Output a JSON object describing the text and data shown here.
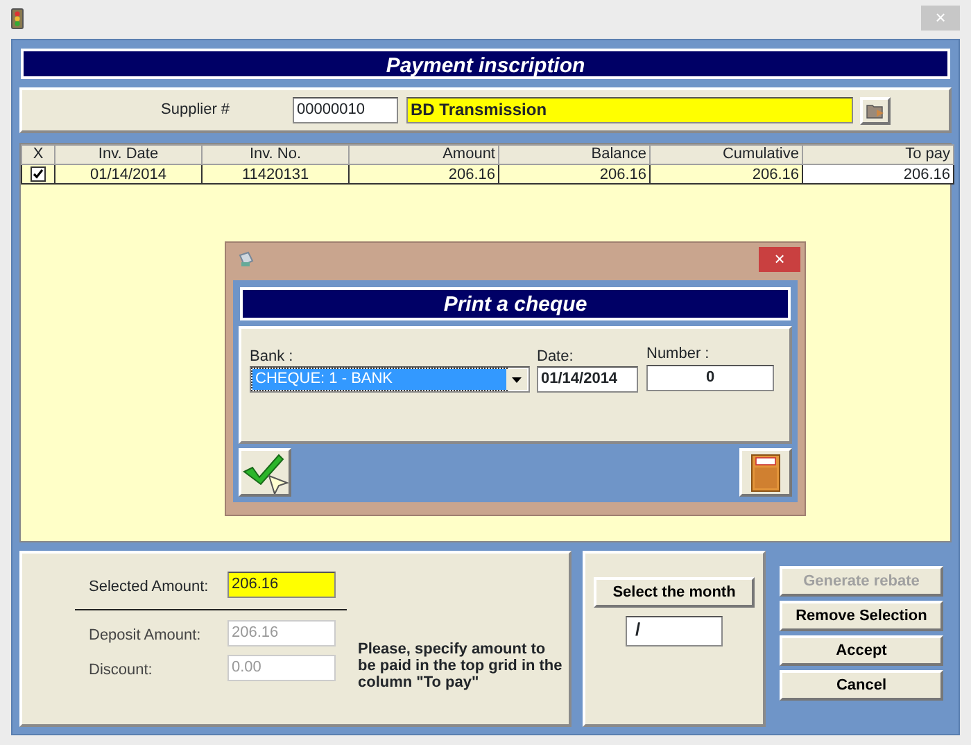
{
  "window": {
    "close": "×"
  },
  "title": "Payment inscription",
  "supplier": {
    "label": "Supplier #",
    "number": "00000010",
    "name": "BD Transmission"
  },
  "table": {
    "columns": [
      "X",
      "Inv. Date",
      "Inv. No.",
      "Amount",
      "Balance",
      "Cumulative",
      "To pay"
    ],
    "rows": [
      {
        "checked": true,
        "inv_date": "01/14/2014",
        "inv_no": "11420131",
        "amount": "206.16",
        "balance": "206.16",
        "cumulative": "206.16",
        "to_pay": "206.16"
      }
    ]
  },
  "dialog": {
    "close": "×",
    "title": "Print a cheque",
    "bank_label": "Bank :",
    "bank_value": "CHEQUE: 1 - BANK",
    "date_label": "Date:",
    "date_value": "01/14/2014",
    "number_label": "Number :",
    "number_value": "0"
  },
  "summary": {
    "fields": [
      {
        "label": "Selected Amount:",
        "value": "206.16",
        "disabled": false
      },
      {
        "label": "Deposit Amount:",
        "value": "206.16",
        "disabled": true
      },
      {
        "label": "Discount:",
        "value": "0.00",
        "disabled": true
      }
    ],
    "note": "Please, specify amount to be paid in the top grid in the column \"To pay\""
  },
  "month": {
    "button": "Select the month",
    "value": "/"
  },
  "buttons": [
    {
      "label": "Generate rebate",
      "disabled": true
    },
    {
      "label": "Remove Selection",
      "disabled": false
    },
    {
      "label": "Accept",
      "disabled": false
    },
    {
      "label": "Cancel",
      "disabled": false
    }
  ]
}
